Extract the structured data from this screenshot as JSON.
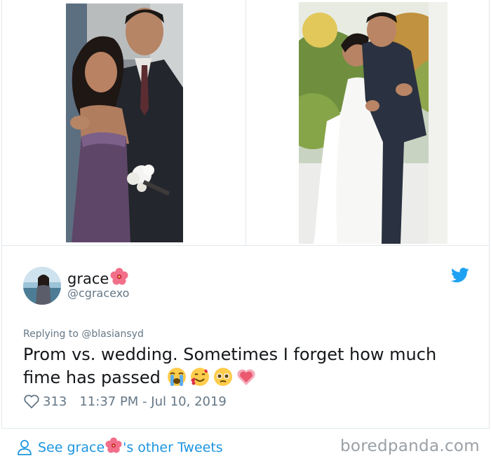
{
  "tweet": {
    "display_name": "grace",
    "handle": "@cgracexo",
    "reply_label": "Replying to",
    "reply_handle": "@blasiansyd",
    "text_line1": "Prom vs. wedding. Sometimes I forget how much",
    "text_line2": "fime has passed",
    "like_count": "313",
    "timestamp": "11:37 PM - Jul 10, 2019"
  },
  "footer": {
    "see_prefix": "See grace",
    "see_suffix": "'s other Tweets",
    "watermark": "boredpanda.com"
  },
  "icons": {
    "name_emoji": "hibiscus-flower",
    "text_emojis": [
      "crying-face",
      "smiling-face-with-hearts",
      "pleading-face",
      "growing-heart"
    ],
    "platform": "twitter-bird",
    "like": "heart-outline",
    "profile": "person-outline"
  },
  "colors": {
    "link": "#1b95e0",
    "muted": "#657786",
    "text": "#14171a",
    "twitter_blue": "#1da1f2"
  },
  "images": {
    "left_photo": "prom photo: couple in purple gown and dark suit",
    "right_photo": "wedding photo: couple embracing, white gown and dark suit"
  }
}
